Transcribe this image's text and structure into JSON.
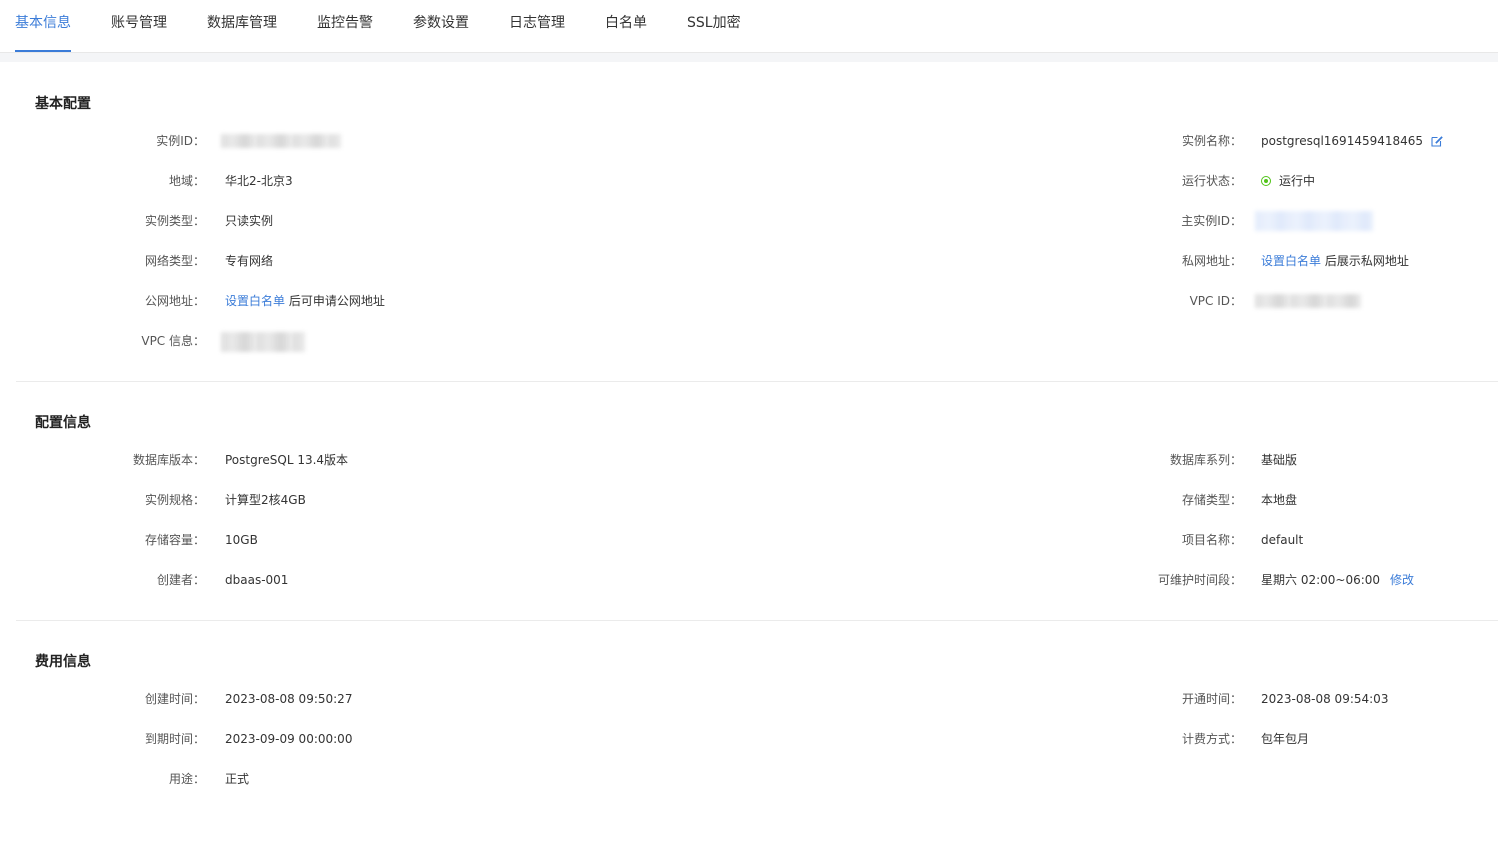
{
  "tabs": [
    {
      "label": "基本信息"
    },
    {
      "label": "账号管理"
    },
    {
      "label": "数据库管理"
    },
    {
      "label": "监控告警"
    },
    {
      "label": "参数设置"
    },
    {
      "label": "日志管理"
    },
    {
      "label": "白名单"
    },
    {
      "label": "SSL加密"
    }
  ],
  "basic": {
    "title": "基本配置",
    "instance_id_label": "实例ID：",
    "region_label": "地域：",
    "region_value": "华北2-北京3",
    "instance_type_label": "实例类型：",
    "instance_type_value": "只读实例",
    "network_type_label": "网络类型：",
    "network_type_value": "专有网络",
    "public_addr_label": "公网地址：",
    "public_addr_link": "设置白名单",
    "public_addr_suffix": "后可申请公网地址",
    "vpc_info_label": "VPC 信息：",
    "instance_name_label": "实例名称：",
    "instance_name_value": "postgresql1691459418465",
    "run_status_label": "运行状态：",
    "run_status_value": "运行中",
    "master_id_label": "主实例ID：",
    "private_addr_label": "私网地址：",
    "private_addr_link": "设置白名单",
    "private_addr_suffix": "后展示私网地址",
    "vpc_id_label": "VPC ID：",
    "status_color": "#52c41a"
  },
  "config": {
    "title": "配置信息",
    "db_version_label": "数据库版本：",
    "db_version_value": "PostgreSQL 13.4版本",
    "spec_label": "实例规格：",
    "spec_value": "计算型2核4GB",
    "storage_label": "存储容量：",
    "storage_value": "10GB",
    "creator_label": "创建者：",
    "creator_value": "dbaas-001",
    "db_series_label": "数据库系列：",
    "db_series_value": "基础版",
    "storage_type_label": "存储类型：",
    "storage_type_value": "本地盘",
    "project_label": "项目名称：",
    "project_value": "default",
    "maint_label": "可维护时间段：",
    "maint_value": "星期六 02:00~06:00",
    "maint_edit": "修改"
  },
  "billing": {
    "title": "费用信息",
    "create_time_label": "创建时间：",
    "create_time_value": "2023-08-08 09:50:27",
    "expire_time_label": "到期时间：",
    "expire_time_value": "2023-09-09 00:00:00",
    "usage_label": "用途：",
    "usage_value": "正式",
    "open_time_label": "开通时间：",
    "open_time_value": "2023-08-08 09:54:03",
    "billing_method_label": "计费方式：",
    "billing_method_value": "包年包月"
  },
  "theme": {
    "accent": "#3b7cd8"
  }
}
